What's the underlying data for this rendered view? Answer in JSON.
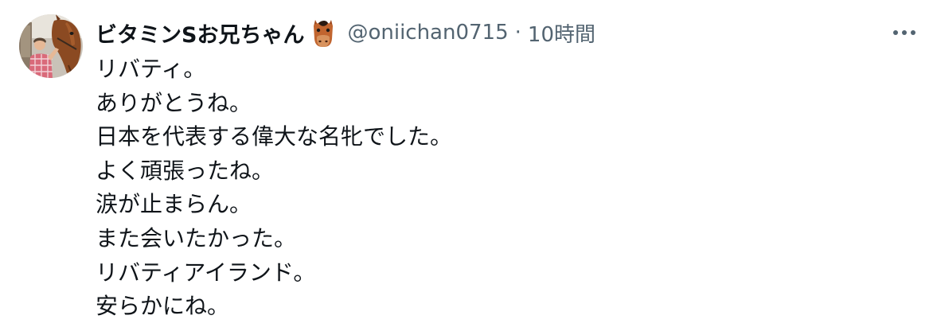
{
  "tweet": {
    "author": {
      "display_name": "ビタミンSお兄ちゃん",
      "name_emoji": "horse-face-emoji",
      "handle": "@oniichan0715",
      "avatar": "avatar-person-with-horse"
    },
    "separator": "·",
    "timestamp": "10時間",
    "more_icon": "more-horizontal-icon",
    "lines": [
      "リバティ。",
      "ありがとうね。",
      "日本を代表する偉大な名牝でした。",
      "よく頑張ったね。",
      "涙が止まらん。",
      "また会いたかった。",
      "リバティアイランド。",
      "安らかにね。"
    ]
  },
  "colors": {
    "text_primary": "#0f1419",
    "text_secondary": "#536471",
    "background": "#ffffff"
  }
}
